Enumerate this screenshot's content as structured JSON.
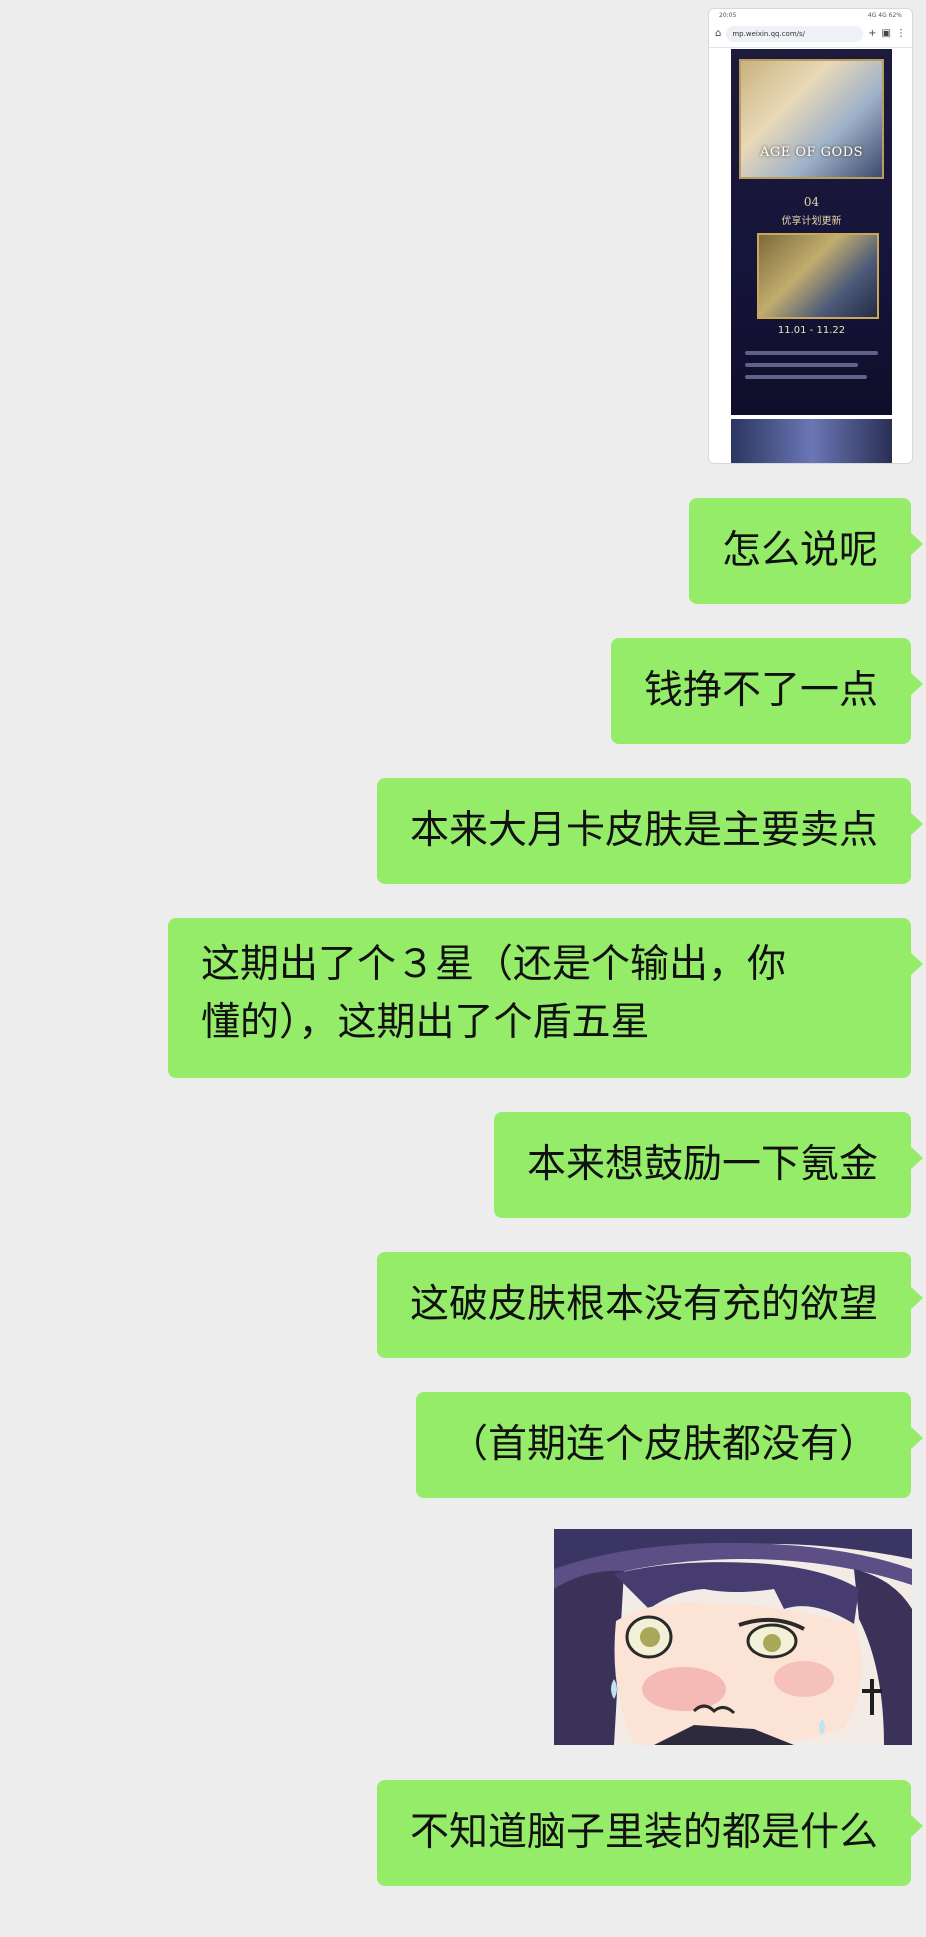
{
  "screenshot_message": {
    "status_time": "20:05",
    "status_right": "4G 4G 62%",
    "url": "mp.weixin.qq.com/s/",
    "banner_title": "AGE OF GODS",
    "section_number": "04",
    "section_title": "优享计划更新",
    "date_range": "11.01 - 11.22"
  },
  "messages": [
    {
      "text": "怎么说呢"
    },
    {
      "text": "钱挣不了一点"
    },
    {
      "text": "本来大月卡皮肤是主要卖点"
    },
    {
      "line1": "这期出了个３星（还是个输出，你",
      "line2": "懂的），这期出了个盾五星"
    },
    {
      "text": "本来想鼓励一下氪金"
    },
    {
      "text": "这破皮肤根本没有充的欲望"
    },
    {
      "text": "（首期连个皮肤都没有）"
    },
    {
      "text": "不知道脑子里装的都是什么"
    }
  ],
  "colors": {
    "background": "#ededed",
    "bubble": "#95ec69",
    "text": "#111111"
  }
}
